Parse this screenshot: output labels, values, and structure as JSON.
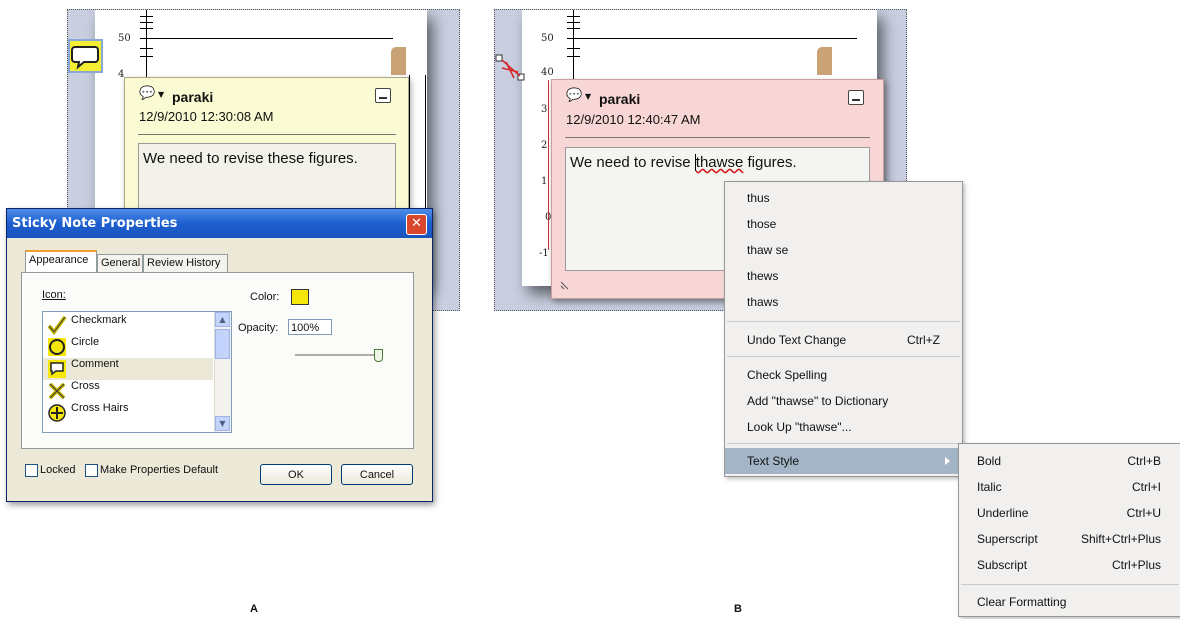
{
  "panel_a": {
    "caption": "A",
    "ticks": [
      "50",
      "4"
    ],
    "note": {
      "author": "paraki",
      "date": "12/9/2010 12:30:08 AM",
      "text": "We need to revise these figures."
    },
    "dialog": {
      "title": "Sticky Note Properties",
      "close_glyph": "✕",
      "tabs": [
        "Appearance",
        "General",
        "Review History"
      ],
      "icon_label": "Icon:",
      "icons": [
        {
          "name": "Checkmark",
          "icon": "checkmark-icon"
        },
        {
          "name": "Circle",
          "icon": "circle-icon"
        },
        {
          "name": "Comment",
          "icon": "comment-icon"
        },
        {
          "name": "Cross",
          "icon": "cross-icon"
        },
        {
          "name": "Cross Hairs",
          "icon": "cross-hairs-icon"
        }
      ],
      "selected_icon": "Comment",
      "color_label": "Color:",
      "color_value": "#f5e70c",
      "opacity_label": "Opacity:",
      "opacity_value": "100%",
      "opacity_level": 1.0,
      "locked_label": "Locked",
      "make_default_label": "Make Properties Default",
      "ok_label": "OK",
      "cancel_label": "Cancel"
    }
  },
  "panel_b": {
    "caption": "B",
    "ticks": [
      "50",
      "40",
      "3",
      "2",
      "1",
      "0",
      "-1"
    ],
    "note": {
      "author": "paraki",
      "date": "12/9/2010 12:40:47 AM",
      "text_before": "We need to revise ",
      "misspelled": "thawse",
      "text_after": " figures."
    },
    "context_menu": {
      "suggestions": [
        "thus",
        "those",
        "thaw se",
        "thews",
        "thaws"
      ],
      "undo": {
        "label": "Undo Text Change",
        "shortcut": "Ctrl+Z"
      },
      "check_spelling": "Check Spelling",
      "add_to_dictionary": "Add \"thawse\" to Dictionary",
      "look_up": "Look Up \"thawse\"...",
      "text_style": "Text Style"
    },
    "submenu": {
      "items": [
        {
          "label": "Bold",
          "shortcut": "Ctrl+B"
        },
        {
          "label": "Italic",
          "shortcut": "Ctrl+I"
        },
        {
          "label": "Underline",
          "shortcut": "Ctrl+U"
        },
        {
          "label": "Superscript",
          "shortcut": "Shift+Ctrl+Plus"
        },
        {
          "label": "Subscript",
          "shortcut": "Ctrl+Plus"
        }
      ],
      "clear_formatting": "Clear Formatting"
    }
  },
  "colors": {
    "note_yellow": "#fbfbd3",
    "note_pink": "#f9d6d6",
    "menu_highlight": "#a3b5c7",
    "title_bar": "#1d5fcf"
  }
}
